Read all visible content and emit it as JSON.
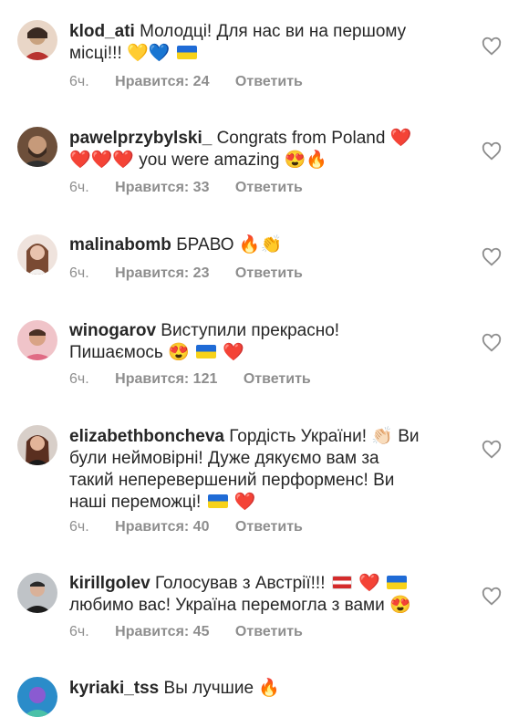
{
  "comments": [
    {
      "username": "klod_ati",
      "text": "Молодці! Для нас ви на першому місці!!! 💛💙 🇺🇦",
      "line1": "Молодці! Для нас ви на першому",
      "line2": "місці!!!",
      "emoji": "💛💙",
      "time": "6ч.",
      "likes": "Нравится: 24",
      "reply": "Ответить"
    },
    {
      "username": "pawelprzybylski_",
      "line1": "Congrats from Poland ❤️",
      "line2": "❤️❤️❤️ you were amazing 😍🔥",
      "time": "6ч.",
      "likes": "Нравится: 33",
      "reply": "Ответить"
    },
    {
      "username": "malinabomb",
      "line1": "БРАВО 🔥👏",
      "time": "6ч.",
      "likes": "Нравится: 23",
      "reply": "Ответить"
    },
    {
      "username": "winogarov",
      "line1": "Виступили прекрасно!",
      "line2a": "Пишаємось 😍",
      "line2b": "❤️",
      "time": "6ч.",
      "likes": "Нравится: 121",
      "reply": "Ответить"
    },
    {
      "username": "elizabethboncheva",
      "line1": "Гордість України! 👏🏻 Ви",
      "line2": "були неймовірні! Дуже дякуємо вам за",
      "line3": "такий неперевершений перформенс! Ви",
      "line4a": "наші переможці!",
      "line4b": "❤️",
      "time": "6ч.",
      "likes": "Нравится: 40",
      "reply": "Ответить"
    },
    {
      "username": "kirillgolev",
      "line1a": "Голосував з Австрії!!!",
      "line1b": "❤️",
      "line2": "любимо вас! Україна перемогла з вами 😍",
      "time": "6ч.",
      "likes": "Нравится: 45",
      "reply": "Ответить"
    },
    {
      "username": "kyriaki_tss",
      "line1": "Вы лучшие 🔥"
    }
  ],
  "colors": {
    "text": "#262626",
    "meta": "#8e8e8e"
  },
  "icons": {
    "like": "heart-outline-icon"
  }
}
